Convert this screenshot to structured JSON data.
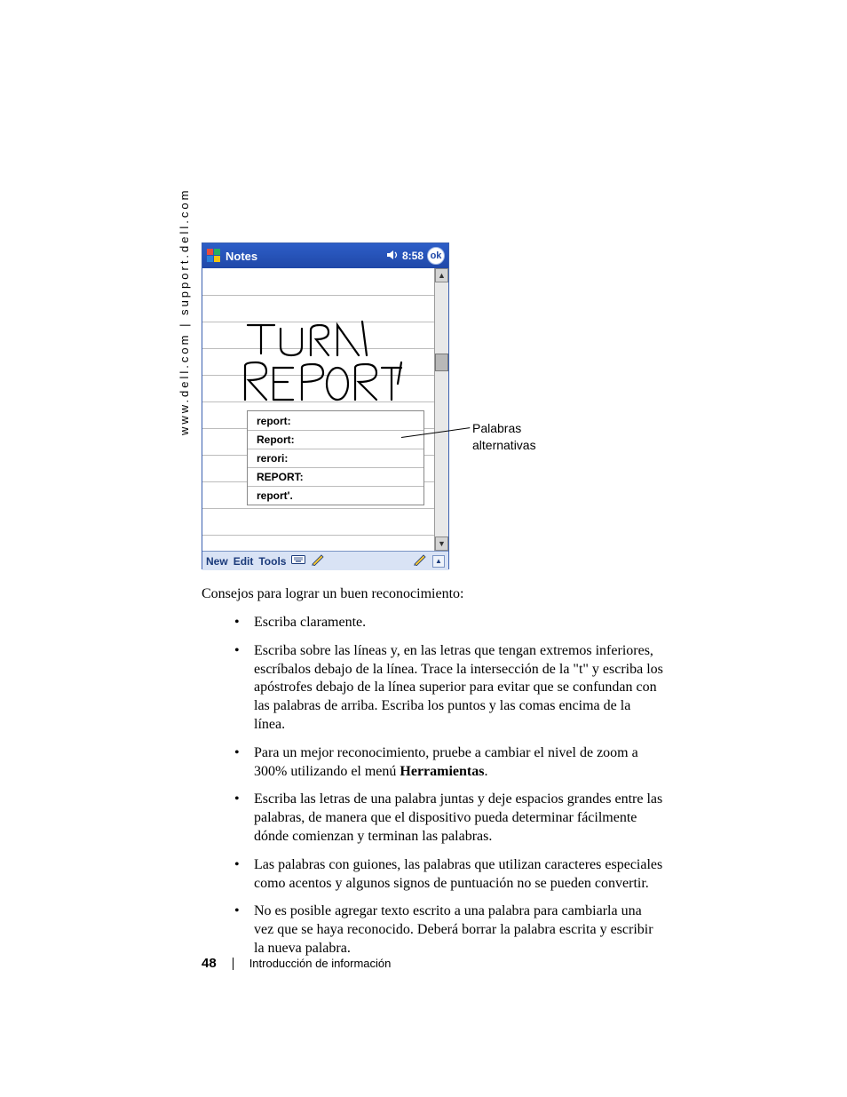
{
  "side_url": "www.dell.com | support.dell.com",
  "pda": {
    "title": "Notes",
    "time": "8:58",
    "ok": "ok",
    "alternatives": [
      "report:",
      "Report:",
      "rerori:",
      "REPORT:",
      "report'."
    ],
    "bottom": {
      "new": "New",
      "edit": "Edit",
      "tools": "Tools"
    }
  },
  "callout": {
    "line1": "Palabras",
    "line2": "alternativas"
  },
  "intro": "Consejos para lograr un buen reconocimiento:",
  "tips": {
    "t1": "Escriba claramente.",
    "t2": "Escriba sobre las líneas y, en las letras que tengan extremos inferiores, escríbalos debajo de la línea. Trace la intersección de la \"t\" y escriba los apóstrofes debajo de la línea superior para evitar que se confundan con las palabras de arriba. Escriba los puntos y las comas encima de la línea.",
    "t3a": "Para un mejor reconocimiento, pruebe a cambiar el nivel de zoom a 300% utilizando el menú ",
    "t3b": "Herramientas",
    "t3c": ".",
    "t4": "Escriba las letras de una palabra juntas y deje espacios grandes entre las palabras, de manera que el dispositivo pueda determinar fácilmente dónde comienzan y terminan las palabras.",
    "t5": "Las palabras con guiones, las palabras que utilizan caracteres especiales como acentos y algunos signos de puntuación no se pueden convertir.",
    "t6": "No es posible agregar texto escrito a una palabra para cambiarla una vez que se haya reconocido. Deberá borrar la palabra escrita y escribir la nueva palabra."
  },
  "footer": {
    "page": "48",
    "section": "Introducción de información"
  }
}
